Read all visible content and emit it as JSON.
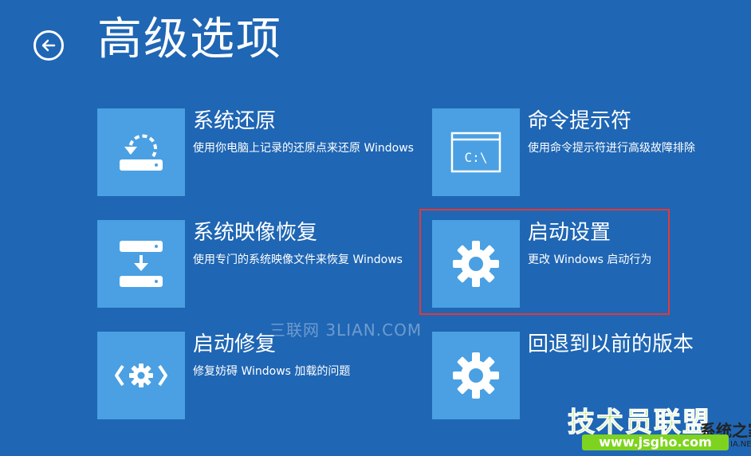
{
  "page": {
    "title": "高级选项",
    "background": "#1f66b4",
    "tile_color": "#4aa0e2",
    "highlight_color": "#e53935"
  },
  "back_button": {
    "icon": "back-arrow-icon"
  },
  "options": [
    {
      "title": "系统还原",
      "description": "使用你电脑上记录的还原点来还原 Windows",
      "icon": "system-restore-icon"
    },
    {
      "title": "命令提示符",
      "description": "使用命令提示符进行高级故障排除",
      "icon": "command-prompt-icon",
      "icon_text": "C:\\"
    },
    {
      "title": "系统映像恢复",
      "description": "使用专门的系统映像文件来恢复 Windows",
      "icon": "image-recovery-icon"
    },
    {
      "title": "启动设置",
      "description": "更改 Windows 启动行为",
      "icon": "gear-icon",
      "selected": true
    },
    {
      "title": "启动修复",
      "description": "修复妨碍 Windows 加载的问题",
      "icon": "startup-repair-icon"
    },
    {
      "title": "回退到以前的版本",
      "description": "",
      "icon": "gear-icon"
    }
  ],
  "watermarks": {
    "middle": "三联网 3LIAN.COM",
    "corner_brand": "技术员联盟",
    "corner_suffix": "系统之家",
    "corner_url": "www.jsgho.com",
    "corner_net": "IA.NET"
  }
}
